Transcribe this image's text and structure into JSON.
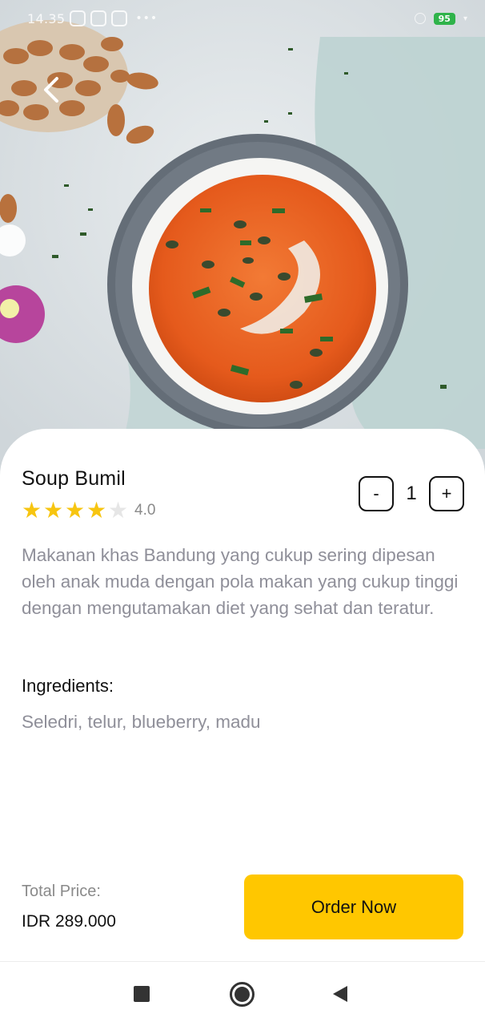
{
  "status_bar": {
    "time": "14.35",
    "battery": "95"
  },
  "product": {
    "name": "Soup Bumil",
    "rating": 4,
    "rating_max": 5,
    "rating_text": "4.0",
    "description": "Makanan khas Bandung yang cukup sering dipesan oleh anak muda dengan pola makan yang cukup tinggi dengan mengutamakan diet yang sehat dan teratur.",
    "ingredients_label": "Ingredients:",
    "ingredients": "Seledri, telur, blueberry, madu"
  },
  "quantity": {
    "decrement_label": "-",
    "value": "1",
    "increment_label": "+"
  },
  "checkout": {
    "total_label": "Total Price:",
    "total_value": "IDR 289.000",
    "order_button_label": "Order Now"
  },
  "colors": {
    "accent": "#ffc700",
    "star": "#f7c510",
    "soup": "#e8601e",
    "text_muted": "#8f8f99"
  },
  "icons": {
    "back": "chevron-left-icon",
    "nav_recents": "square-icon",
    "nav_home": "circle-icon",
    "nav_back": "triangle-left-icon"
  }
}
